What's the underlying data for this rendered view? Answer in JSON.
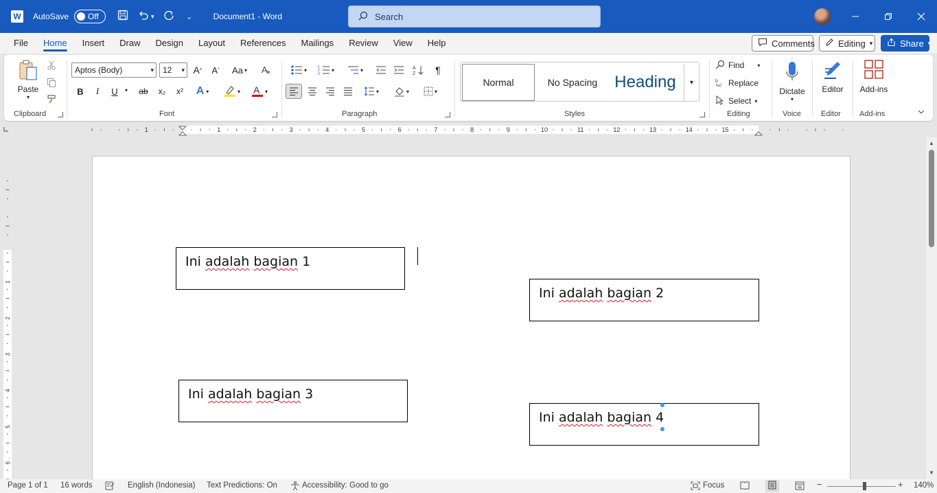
{
  "titlebar": {
    "autosave_label": "AutoSave",
    "autosave_state": "Off",
    "doc_title": "Document1  -  Word",
    "search_placeholder": "Search",
    "accent": "#185abd"
  },
  "menu": {
    "tabs": [
      "File",
      "Home",
      "Insert",
      "Draw",
      "Design",
      "Layout",
      "References",
      "Mailings",
      "Review",
      "View",
      "Help"
    ],
    "active_tab": "Home",
    "comments_label": "Comments",
    "editing_label": "Editing",
    "share_label": "Share"
  },
  "ribbon": {
    "clipboard": {
      "paste_label": "Paste",
      "group_label": "Clipboard"
    },
    "font": {
      "font_name": "Aptos (Body)",
      "font_size": "12",
      "bold": "B",
      "italic": "I",
      "underline": "U",
      "strike": "ab",
      "sub": "x₂",
      "sup": "x²",
      "group_label": "Font",
      "grow": "A^",
      "shrink": "Aˇ",
      "case": "Aa"
    },
    "paragraph": {
      "group_label": "Paragraph"
    },
    "styles": {
      "items": [
        "Normal",
        "No Spacing",
        "Heading"
      ],
      "group_label": "Styles"
    },
    "editing": {
      "find_label": "Find",
      "replace_label": "Replace",
      "select_label": "Select",
      "group_label": "Editing"
    },
    "voice": {
      "dictate_label": "Dictate",
      "group_label": "Voice"
    },
    "editor": {
      "editor_label": "Editor",
      "group_label": "Editor"
    },
    "addins": {
      "addins_label": "Add-ins",
      "group_label": "Add-ins"
    }
  },
  "ruler": {
    "h_numbers": [
      "1",
      "1",
      "2",
      "3",
      "4",
      "5",
      "6",
      "7",
      "8",
      "9",
      "10",
      "11",
      "12",
      "13",
      "14",
      "15"
    ],
    "v_numbers": [
      "1",
      "2",
      "3",
      "4",
      "5",
      "6"
    ]
  },
  "document": {
    "textboxes": [
      {
        "prefix": "Ini ",
        "words": [
          "adalah",
          "bagian"
        ],
        "suffix": " 1"
      },
      {
        "prefix": "Ini ",
        "words": [
          "adalah",
          "bagian"
        ],
        "suffix": " 2"
      },
      {
        "prefix": "Ini ",
        "words": [
          "adalah",
          "bagian"
        ],
        "suffix": " 3"
      },
      {
        "prefix": "Ini ",
        "words": [
          "adalah",
          "bagian"
        ],
        "suffix": " 4"
      }
    ]
  },
  "statusbar": {
    "page": "Page 1 of 1",
    "words": "16 words",
    "language": "English (Indonesia)",
    "predictions": "Text Predictions: On",
    "accessibility": "Accessibility: Good to go",
    "focus": "Focus",
    "zoom": "140%"
  }
}
